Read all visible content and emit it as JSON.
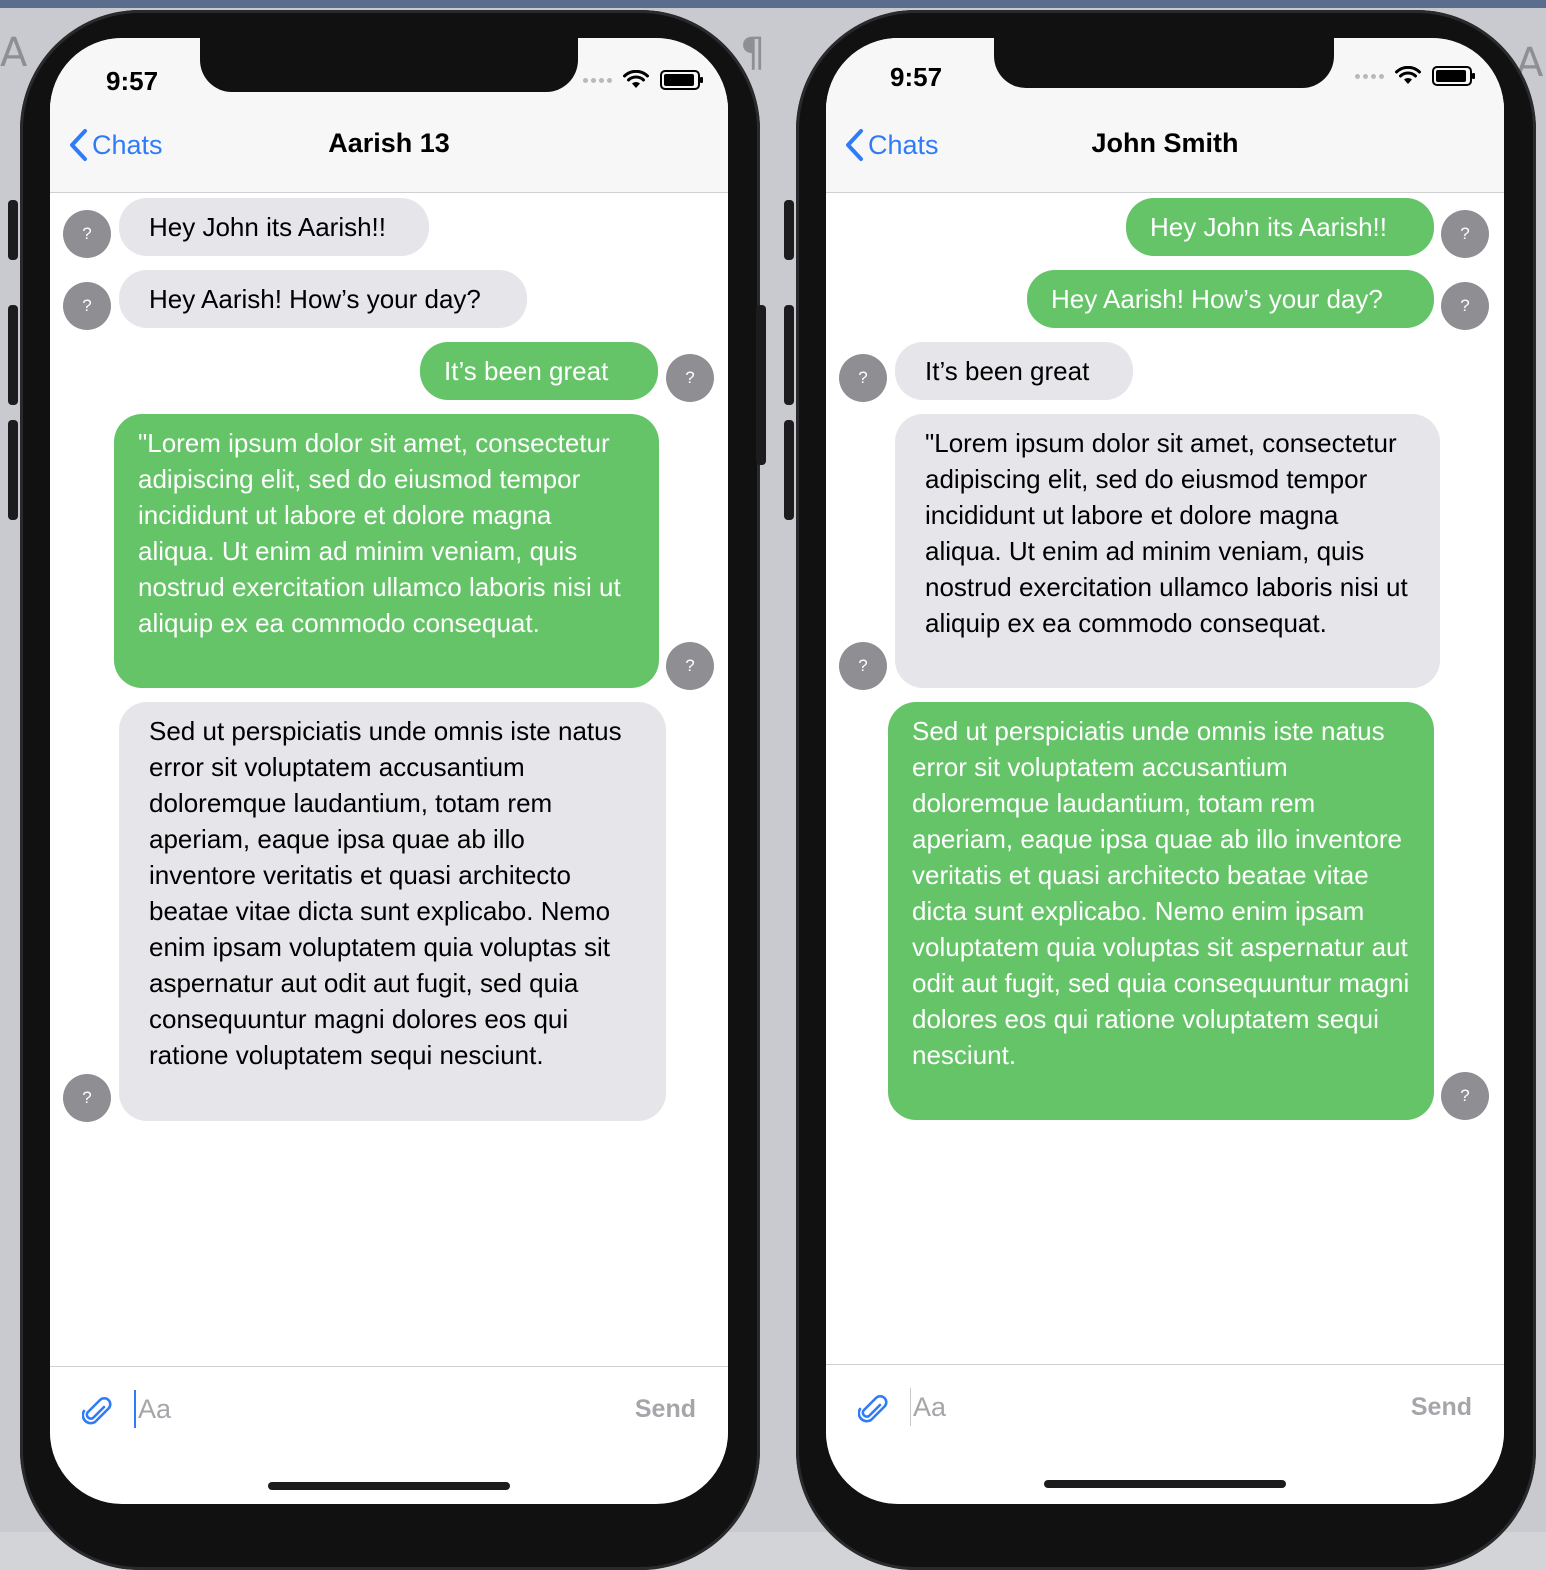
{
  "background_glyphs": [
    "A",
    "¶",
    "A"
  ],
  "phones": [
    {
      "status_time": "9:57",
      "back_label": "Chats",
      "title": "Aarish 13",
      "input_placeholder": "Aa",
      "send_label": "Send",
      "avatar_glyph": "?",
      "messages": [
        {
          "direction": "in",
          "text": "Hey John its Aarish!!"
        },
        {
          "direction": "in",
          "text": "Hey Aarish! How’s your day?"
        },
        {
          "direction": "out",
          "text": "It’s been great"
        },
        {
          "direction": "out",
          "text": "\"Lorem ipsum dolor sit amet, consectetur adipiscing elit, sed do eiusmod tempor incididunt ut labore et dolore magna aliqua. Ut enim ad minim veniam, quis nostrud exercitation ullamco laboris nisi ut aliquip ex ea commodo consequat."
        },
        {
          "direction": "in",
          "text": "Sed ut perspiciatis unde omnis iste natus error sit voluptatem accusantium doloremque laudantium, totam rem aperiam, eaque ipsa quae ab illo inventore veritatis et quasi architecto beatae vitae dicta sunt explicabo. Nemo enim ipsam voluptatem quia voluptas sit aspernatur aut odit aut fugit, sed quia consequuntur magni dolores eos qui ratione voluptatem sequi nesciunt."
        }
      ]
    },
    {
      "status_time": "9:57",
      "back_label": "Chats",
      "title": "John Smith",
      "input_placeholder": "Aa",
      "send_label": "Send",
      "avatar_glyph": "?",
      "messages": [
        {
          "direction": "out",
          "text": "Hey John its Aarish!!"
        },
        {
          "direction": "out",
          "text": "Hey Aarish! How’s your day?"
        },
        {
          "direction": "in",
          "text": "It’s been great"
        },
        {
          "direction": "in",
          "text": "\"Lorem ipsum dolor sit amet, consectetur adipiscing elit, sed do eiusmod tempor incididunt ut labore et dolore magna aliqua. Ut enim ad minim veniam, quis nostrud exercitation ullamco laboris nisi ut aliquip ex ea commodo consequat."
        },
        {
          "direction": "out",
          "text": "Sed ut perspiciatis unde omnis iste natus error sit voluptatem accusantium doloremque laudantium, totam rem aperiam, eaque ipsa quae ab illo inventore veritatis et quasi architecto beatae vitae dicta sunt explicabo. Nemo enim ipsam voluptatem quia voluptas sit aspernatur aut odit aut fugit, sed quia consequuntur magni dolores eos qui ratione voluptatem sequi nesciunt."
        }
      ]
    }
  ],
  "colors": {
    "accent_blue": "#2f7cf6",
    "outgoing_bubble": "#64c467",
    "incoming_bubble": "#e5e5ea",
    "avatar_gray": "#8e8e93",
    "phone_frame": "#111112"
  },
  "icons": {
    "back": "chevron-left-icon",
    "attach": "paperclip-icon",
    "wifi": "wifi-icon",
    "battery": "battery-icon",
    "signal": "cellular-signal-icon"
  }
}
